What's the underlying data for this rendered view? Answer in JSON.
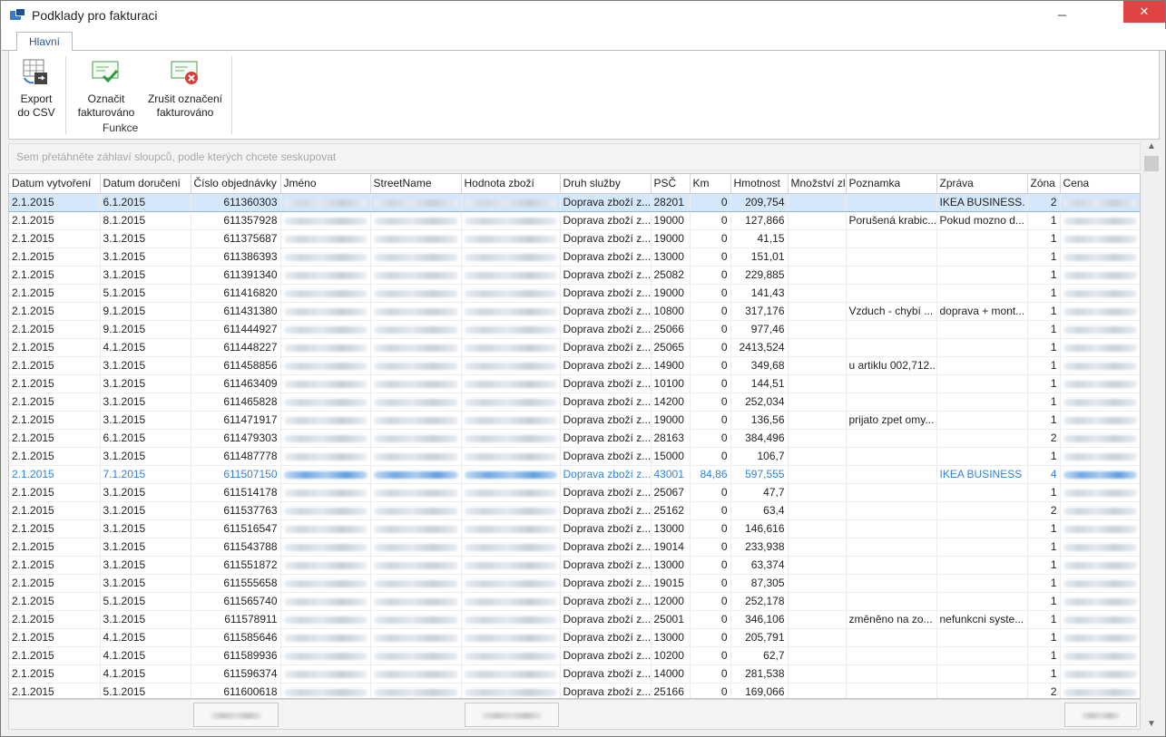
{
  "window": {
    "title": "Podklady pro fakturaci",
    "minimize": "─",
    "maximize": "□",
    "close": "✕"
  },
  "ribbon": {
    "tab": "Hlavní",
    "export_label": "Export\ndo CSV",
    "mark_label": "Označit\nfakturováno",
    "unmark_label": "Zrušit označení\nfakturováno",
    "group": "Funkce"
  },
  "group_panel_hint": "Sem přetáhněte záhlaví sloupců, podle kterých chcete seskupovat",
  "columns": [
    "Datum vytvoření",
    "Datum doručení",
    "Číslo objednávky",
    "Jméno",
    "StreetName",
    "Hodnota zboží",
    "Druh služby",
    "PSČ",
    "Km",
    "Hmotnost",
    "Množství zl",
    "Poznamka",
    "Zpráva",
    "Zóna",
    "Cena"
  ],
  "rows": [
    [
      "2.1.2015",
      "6.1.2015",
      "611360303",
      "",
      "",
      "",
      "Doprava zboží z...",
      "28201",
      "0",
      "209,754",
      "",
      "",
      "IKEA BUSINESS.",
      "2",
      ""
    ],
    [
      "2.1.2015",
      "8.1.2015",
      "611357928",
      "",
      "",
      "",
      "Doprava zboží z...",
      "19000",
      "0",
      "127,866",
      "",
      "Porušená krabic...",
      "Pokud mozno d...",
      "1",
      ""
    ],
    [
      "2.1.2015",
      "3.1.2015",
      "611375687",
      "",
      "",
      "",
      "Doprava zboží z...",
      "19000",
      "0",
      "41,15",
      "",
      "",
      "",
      "1",
      ""
    ],
    [
      "2.1.2015",
      "3.1.2015",
      "611386393",
      "",
      "",
      "",
      "Doprava zboží z...",
      "13000",
      "0",
      "151,01",
      "",
      "",
      "",
      "1",
      ""
    ],
    [
      "2.1.2015",
      "3.1.2015",
      "611391340",
      "",
      "",
      "",
      "Doprava zboží z...",
      "25082",
      "0",
      "229,885",
      "",
      "",
      "",
      "1",
      ""
    ],
    [
      "2.1.2015",
      "5.1.2015",
      "611416820",
      "",
      "",
      "",
      "Doprava zboží z...",
      "19000",
      "0",
      "141,43",
      "",
      "",
      "",
      "1",
      ""
    ],
    [
      "2.1.2015",
      "9.1.2015",
      "611431380",
      "",
      "",
      "",
      "Doprava zboží z...",
      "10800",
      "0",
      "317,176",
      "",
      "Vzduch - chybí ...",
      "doprava + mont...",
      "1",
      ""
    ],
    [
      "2.1.2015",
      "9.1.2015",
      "611444927",
      "",
      "",
      "",
      "Doprava zboží z...",
      "25066",
      "0",
      "977,46",
      "",
      "",
      "",
      "1",
      ""
    ],
    [
      "2.1.2015",
      "4.1.2015",
      "611448227",
      "",
      "",
      "",
      "Doprava zboží z...",
      "25065",
      "0",
      "2413,524",
      "",
      "",
      "",
      "1",
      ""
    ],
    [
      "2.1.2015",
      "3.1.2015",
      "611458856",
      "",
      "",
      "",
      "Doprava zboží z...",
      "14900",
      "0",
      "349,68",
      "",
      "u artiklu 002,712...",
      "",
      "1",
      ""
    ],
    [
      "2.1.2015",
      "3.1.2015",
      "611463409",
      "",
      "",
      "",
      "Doprava zboží z...",
      "10100",
      "0",
      "144,51",
      "",
      "",
      "",
      "1",
      ""
    ],
    [
      "2.1.2015",
      "3.1.2015",
      "611465828",
      "",
      "",
      "",
      "Doprava zboží z...",
      "14200",
      "0",
      "252,034",
      "",
      "",
      "",
      "1",
      ""
    ],
    [
      "2.1.2015",
      "3.1.2015",
      "611471917",
      "",
      "",
      "",
      "Doprava zboží z...",
      "19000",
      "0",
      "136,56",
      "",
      "prijato zpet omy...",
      "",
      "1",
      ""
    ],
    [
      "2.1.2015",
      "6.1.2015",
      "611479303",
      "",
      "",
      "",
      "Doprava zboží z...",
      "28163",
      "0",
      "384,496",
      "",
      "",
      "",
      "2",
      ""
    ],
    [
      "2.1.2015",
      "3.1.2015",
      "611487778",
      "",
      "",
      "",
      "Doprava zboží z...",
      "15000",
      "0",
      "106,7",
      "",
      "",
      "",
      "1",
      ""
    ],
    [
      "2.1.2015",
      "7.1.2015",
      "611507150",
      "",
      "",
      "",
      "Doprava zboží z...",
      "43001",
      "84,86",
      "597,555",
      "",
      "",
      "IKEA BUSINESS",
      "4",
      ""
    ],
    [
      "2.1.2015",
      "3.1.2015",
      "611514178",
      "",
      "",
      "",
      "Doprava zboží z...",
      "25067",
      "0",
      "47,7",
      "",
      "",
      "",
      "1",
      ""
    ],
    [
      "2.1.2015",
      "3.1.2015",
      "611537763",
      "",
      "",
      "",
      "Doprava zboží z...",
      "25162",
      "0",
      "63,4",
      "",
      "",
      "",
      "2",
      ""
    ],
    [
      "2.1.2015",
      "3.1.2015",
      "611516547",
      "",
      "",
      "",
      "Doprava zboží z...",
      "13000",
      "0",
      "146,616",
      "",
      "",
      "",
      "1",
      ""
    ],
    [
      "2.1.2015",
      "3.1.2015",
      "611543788",
      "",
      "",
      "",
      "Doprava zboží z...",
      "19014",
      "0",
      "233,938",
      "",
      "",
      "",
      "1",
      ""
    ],
    [
      "2.1.2015",
      "3.1.2015",
      "611551872",
      "",
      "",
      "",
      "Doprava zboží z...",
      "13000",
      "0",
      "63,374",
      "",
      "",
      "",
      "1",
      ""
    ],
    [
      "2.1.2015",
      "3.1.2015",
      "611555658",
      "",
      "",
      "",
      "Doprava zboží z...",
      "19015",
      "0",
      "87,305",
      "",
      "",
      "",
      "1",
      ""
    ],
    [
      "2.1.2015",
      "5.1.2015",
      "611565740",
      "",
      "",
      "",
      "Doprava zboží z...",
      "12000",
      "0",
      "252,178",
      "",
      "",
      "",
      "1",
      ""
    ],
    [
      "2.1.2015",
      "3.1.2015",
      "611578911",
      "",
      "",
      "",
      "Doprava zboží z...",
      "25001",
      "0",
      "346,106",
      "",
      "změněno na zo...",
      "nefunkcni syste...",
      "1",
      ""
    ],
    [
      "2.1.2015",
      "4.1.2015",
      "611585646",
      "",
      "",
      "",
      "Doprava zboží z...",
      "13000",
      "0",
      "205,791",
      "",
      "",
      "",
      "1",
      ""
    ],
    [
      "2.1.2015",
      "4.1.2015",
      "611589936",
      "",
      "",
      "",
      "Doprava zboží z...",
      "10200",
      "0",
      "62,7",
      "",
      "",
      "",
      "1",
      ""
    ],
    [
      "2.1.2015",
      "4.1.2015",
      "611596374",
      "",
      "",
      "",
      "Doprava zboží z...",
      "14000",
      "0",
      "281,538",
      "",
      "",
      "",
      "1",
      ""
    ],
    [
      "2.1.2015",
      "5.1.2015",
      "611600618",
      "",
      "",
      "",
      "Doprava zboží z...",
      "25166",
      "0",
      "169,066",
      "",
      "",
      "",
      "2",
      ""
    ]
  ],
  "selected_row": 0,
  "highlight_row": 15,
  "highlight_color": "#2e83d8",
  "blurred_columns": [
    3,
    4,
    5,
    14
  ]
}
